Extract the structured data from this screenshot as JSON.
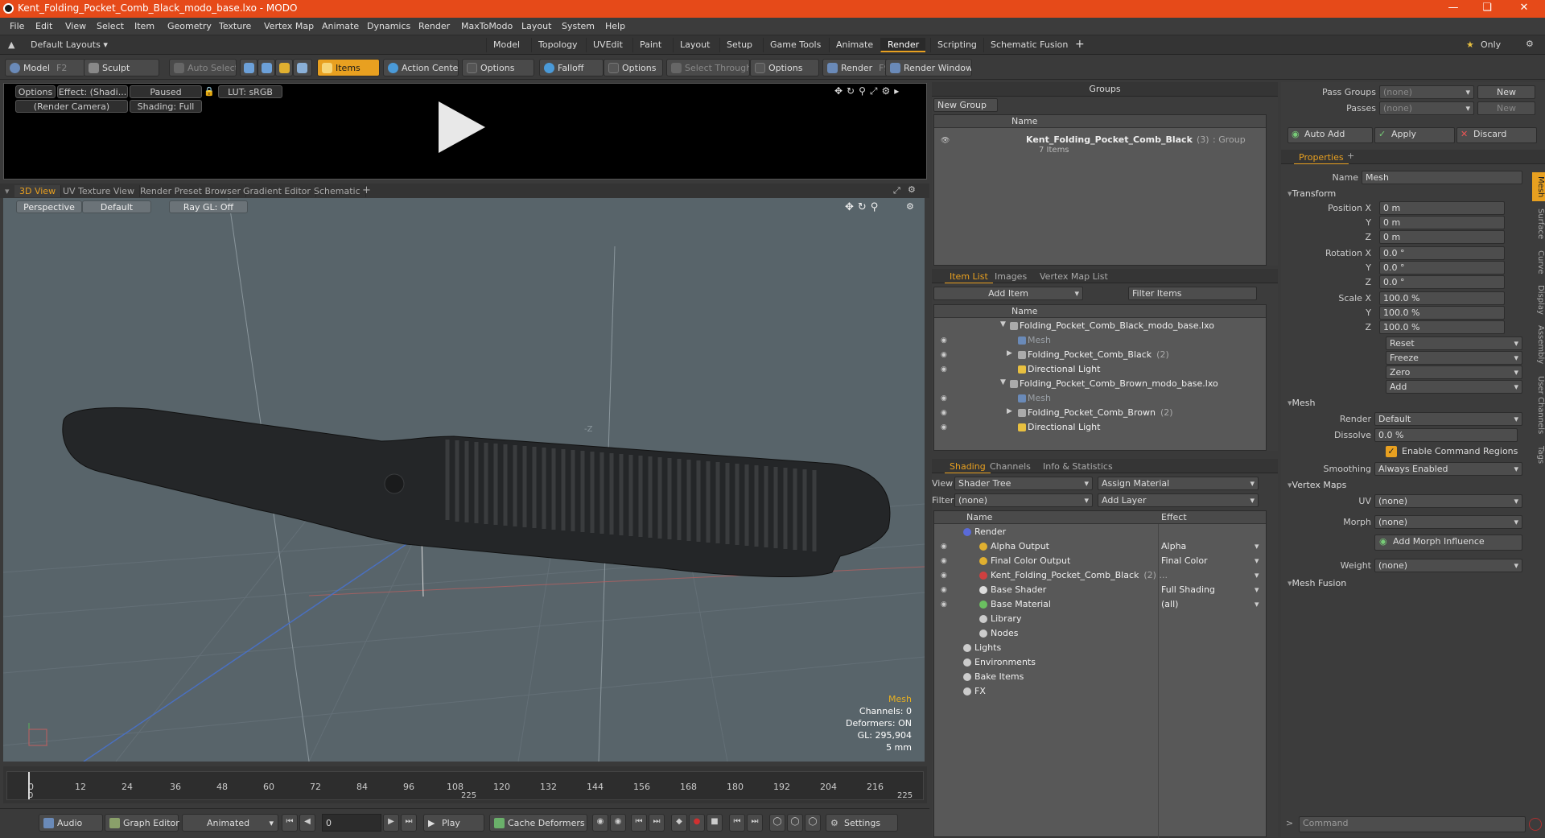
{
  "window": {
    "title": "Kent_Folding_Pocket_Comb_Black_modo_base.lxo - MODO"
  },
  "menu": [
    "File",
    "Edit",
    "View",
    "Select",
    "Item",
    "Geometry",
    "Texture",
    "Vertex Map",
    "Animate",
    "Dynamics",
    "Render",
    "MaxToModo",
    "Layout",
    "System",
    "Help"
  ],
  "layouts": {
    "dropdown": "Default Layouts",
    "tabs": [
      "Model",
      "Topology",
      "UVEdit",
      "Paint",
      "Layout",
      "Setup",
      "Game Tools",
      "Animate",
      "Render",
      "Scripting",
      "Schematic Fusion"
    ],
    "active": "Render",
    "only_label": "Only"
  },
  "toolbar": {
    "model": "Model",
    "model_key": "F2",
    "sculpt": "Sculpt",
    "auto_select": "Auto Select",
    "items": "Items",
    "action_center": "Action Center",
    "options1": "Options",
    "falloff": "Falloff",
    "options2": "Options",
    "select_through": "Select Through",
    "options3": "Options",
    "render": "Render",
    "render_key": "F9",
    "render_window": "Render Window"
  },
  "preview": {
    "options": "Options",
    "effect": "Effect: (Shadi...",
    "paused": "Paused",
    "lut": "LUT: sRGB",
    "camera": "(Render Camera)",
    "shading": "Shading: Full"
  },
  "viewport_tabs": [
    "3D View",
    "UV Texture View",
    "Render Preset Browser",
    "Gradient Editor",
    "Schematic"
  ],
  "viewport": {
    "perspective": "Perspective",
    "default": "Default",
    "raygl": "Ray GL: Off",
    "axis_label": "-Z",
    "info": [
      "Mesh",
      "Channels: 0",
      "Deformers: ON",
      "GL: 295,904",
      "5 mm"
    ]
  },
  "timeline": {
    "ticks": [
      "0",
      "12",
      "24",
      "36",
      "48",
      "60",
      "72",
      "84",
      "96",
      "108",
      "120",
      "132",
      "144",
      "156",
      "168",
      "180",
      "192",
      "204",
      "216"
    ],
    "sub": [
      "0",
      "225",
      "225"
    ]
  },
  "bottom": {
    "audio": "Audio",
    "graph_editor": "Graph Editor",
    "animated": "Animated",
    "frame": "0",
    "play": "Play",
    "cache": "Cache Deformers",
    "settings": "Settings"
  },
  "groups": {
    "title": "Groups",
    "new_group": "New Group",
    "col_name": "Name",
    "item_name": "Kent_Folding_Pocket_Comb_Black",
    "item_count": "(3)",
    "item_type": ": Group",
    "item_sub": "7 Items"
  },
  "itemlist": {
    "tabs": [
      "Item List",
      "Images",
      "Vertex Map List"
    ],
    "add_item": "Add Item",
    "filter": "Filter Items",
    "col_name": "Name",
    "rows": [
      {
        "label": "Folding_Pocket_Comb_Black_modo_base.lxo",
        "indent": 0,
        "dim": false
      },
      {
        "label": "Mesh",
        "indent": 1,
        "dim": true
      },
      {
        "label": "Folding_Pocket_Comb_Black",
        "extra": "(2)",
        "indent": 1,
        "dim": false
      },
      {
        "label": "Directional Light",
        "indent": 1,
        "dim": false
      },
      {
        "label": "Folding_Pocket_Comb_Brown_modo_base.lxo",
        "indent": 0,
        "dim": false
      },
      {
        "label": "Mesh",
        "indent": 1,
        "dim": true
      },
      {
        "label": "Folding_Pocket_Comb_Brown",
        "extra": "(2)",
        "indent": 1,
        "dim": false
      },
      {
        "label": "Directional Light",
        "indent": 1,
        "dim": false
      }
    ]
  },
  "shading": {
    "tabs": [
      "Shading",
      "Channels",
      "Info & Statistics"
    ],
    "view_label": "View",
    "view_value": "Shader Tree",
    "assign": "Assign Material",
    "filter_label": "Filter",
    "filter_value": "(none)",
    "add_layer": "Add Layer",
    "col_name": "Name",
    "col_effect": "Effect",
    "rows": [
      {
        "label": "Render",
        "effect": ""
      },
      {
        "label": "Alpha Output",
        "effect": "Alpha"
      },
      {
        "label": "Final Color Output",
        "effect": "Final Color"
      },
      {
        "label": "Kent_Folding_Pocket_Comb_Black",
        "extra": "(2) ...",
        "effect": ""
      },
      {
        "label": "Base Shader",
        "effect": "Full Shading"
      },
      {
        "label": "Base Material",
        "effect": "(all)"
      },
      {
        "label": "Library",
        "effect": ""
      },
      {
        "label": "Nodes",
        "effect": ""
      },
      {
        "label": "Lights",
        "effect": ""
      },
      {
        "label": "Environments",
        "effect": ""
      },
      {
        "label": "Bake Items",
        "effect": ""
      },
      {
        "label": "FX",
        "effect": ""
      }
    ]
  },
  "props": {
    "pass_groups": "Pass Groups",
    "passes": "Passes",
    "none": "(none)",
    "new": "New",
    "auto_add": "Auto Add",
    "apply": "Apply",
    "discard": "Discard",
    "tab": "Properties",
    "name_label": "Name",
    "name_value": "Mesh",
    "transform": "Transform",
    "position": [
      "0 m",
      "0 m",
      "0 m"
    ],
    "rotation": [
      "0.0 °",
      "0.0 °",
      "0.0 °"
    ],
    "scale": [
      "100.0 %",
      "100.0 %",
      "100.0 %"
    ],
    "pos_x": "Position X",
    "rot_x": "Rotation X",
    "scale_x": "Scale X",
    "y": "Y",
    "z": "Z",
    "reset": "Reset",
    "freeze": "Freeze",
    "zero": "Zero",
    "add": "Add",
    "mesh": "Mesh",
    "render_label": "Render",
    "render_value": "Default",
    "dissolve_label": "Dissolve",
    "dissolve_value": "0.0 %",
    "enable_cmd": "Enable Command Regions",
    "smoothing_label": "Smoothing",
    "smoothing_value": "Always Enabled",
    "vertex_maps": "Vertex Maps",
    "uv": "UV",
    "morph": "Morph",
    "add_morph": "Add Morph Influence",
    "weight": "Weight",
    "mesh_fusion": "Mesh Fusion",
    "side_tabs": [
      "Mesh",
      "Surface",
      "Curve",
      "Display",
      "Assembly",
      "User Channels",
      "Tags"
    ],
    "command": "Command"
  }
}
